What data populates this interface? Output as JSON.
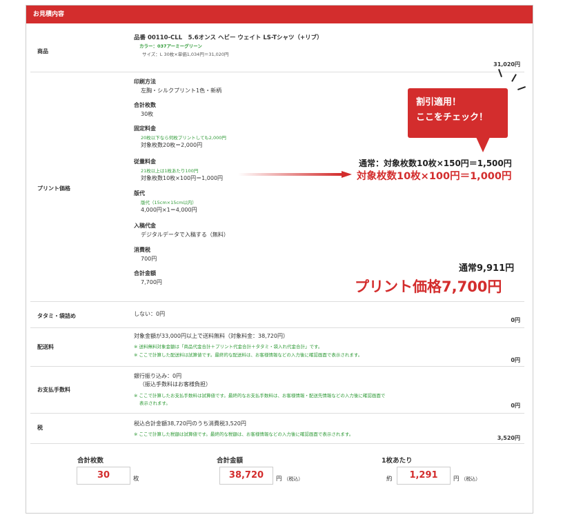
{
  "header": {
    "title": "お見積内容"
  },
  "product": {
    "label": "商品",
    "name": "品番 00110-CLL　5.6オンス ヘビー ウェイト LS-Tシャツ（+リブ）",
    "color": "カラー：037アーミーグリーン",
    "size_line": "サイズ：L 30枚×単価1,034円＝31,020円",
    "amount": "31,020円"
  },
  "print": {
    "label": "プリント価格",
    "method_label": "印刷方法",
    "method_value": "左胸・シルクプリント1色・新柄",
    "count_label": "合計枚数",
    "count_value": "30枚",
    "fixed_label": "固定料金",
    "fixed_note": "20枚以下なら何枚プリントしても2,000円",
    "fixed_value": "対象枚数20枚＝2,000円",
    "variable_label": "従量料金",
    "variable_note": "21枚以上は1枚あたり100円",
    "variable_value": "対象枚数10枚×100円＝1,000円",
    "plate_label": "版代",
    "plate_note": "版代（15cm×15cm以内）",
    "plate_value": "4,000円×1＝4,000円",
    "manuscript_label": "入稿代金",
    "manuscript_value": "デジタルデータで入稿する（無料）",
    "tax_label": "消費税",
    "tax_value": "700円",
    "total_label": "合計金額",
    "total_value": "7,700円"
  },
  "promo": {
    "line1": "割引適用！",
    "line2": "ここをチェック！",
    "normal": "通常：対象枚数10枚×150円＝1,500円",
    "discount": "対象枚数10枚×100円＝1,000円",
    "total_normal": "通常9,911円",
    "total_print": "プリント価格7,700円"
  },
  "folding": {
    "label": "タタミ・袋詰め",
    "value": "しない：0円",
    "amount": "0円"
  },
  "shipping": {
    "label": "配送料",
    "value": "対象金額が33,000円以上で送料無料（対象料金：38,720円）",
    "note1": "※ 送料無料対象金額は「商品代金合計＋プリント代金合計＋タタミ・袋入れ代金合計」です。",
    "note2": "※ ここで計算した配送料は試算値です。最終的な配送料は、お客様情報などの入力後に確認画面で表示されます。",
    "amount": "0円"
  },
  "payment": {
    "label": "お支払手数料",
    "value1": "銀行振り込み：0円",
    "value2": "（振込手数料はお客様負担）",
    "note1": "※ ここで計算したお支払手数料は試算値です。最終的なお支払手数料は、お客様情報・配送先情報などの入力後に確認画面で",
    "note2": "表示されます。",
    "amount": "0円"
  },
  "tax": {
    "label": "税",
    "value": "税込合計金額38,720円のうち消費税3,520円",
    "note": "※ ここで計算した税額は試算値です。最終的な税額は、お客様情報などの入力後に確認画面で表示されます。",
    "amount": "3,520円"
  },
  "summary": {
    "count_label": "合計枚数",
    "count_value": "30",
    "count_unit": "枚",
    "total_label": "合計金額",
    "total_value": "38,720",
    "total_unit": "円",
    "total_tax": "（税込）",
    "per_label": "1枚あたり",
    "per_prefix": "約",
    "per_value": "1,291",
    "per_unit": "円",
    "per_tax": "（税込）"
  },
  "colors": {
    "accent": "#d32d2d",
    "note_green": "#2e9a36"
  }
}
